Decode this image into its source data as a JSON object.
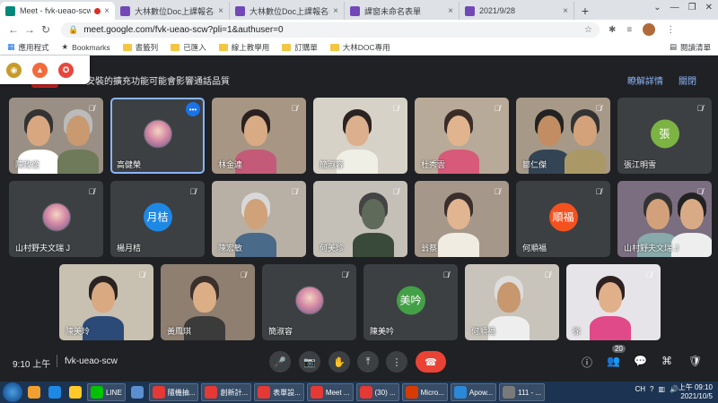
{
  "browser": {
    "tabs": [
      {
        "title": "Meet - fvk-ueao-scw",
        "fav_color": "#00897b",
        "active": true,
        "recording": true
      },
      {
        "title": "大林數位Doc上課報名表",
        "fav_color": "#7248b9",
        "active": false
      },
      {
        "title": "大林數位Doc上課報名表",
        "fav_color": "#7248b9",
        "active": false
      },
      {
        "title": "課窗未命名表單",
        "fav_color": "#7248b9",
        "active": false
      },
      {
        "title": "2021/9/28",
        "fav_color": "#7248b9",
        "active": false
      }
    ],
    "new_tab_label": "+",
    "close_glyph": "×",
    "url": "meet.google.com/fvk-ueao-scw?pli=1&authuser=0",
    "bookmarks": [
      {
        "label": "應用程式",
        "type": "apps"
      },
      {
        "label": "Bookmarks",
        "type": "star"
      },
      {
        "label": "書籤列",
        "type": "folder"
      },
      {
        "label": "已匯入",
        "type": "folder"
      },
      {
        "label": "線上教學用",
        "type": "folder"
      },
      {
        "label": "訂購單",
        "type": "folder"
      },
      {
        "label": "大林DOC專用",
        "type": "folder"
      }
    ],
    "reading_list_label": "閱讀清單"
  },
  "meet": {
    "banner_text": "安裝的擴充功能可能會影響通話品質",
    "banner_learn_more": "瞭解詳情",
    "banner_close": "關閉",
    "participants": [
      {
        "name": "陳政從",
        "kind": "video",
        "scene": "duo"
      },
      {
        "name": "高健榮",
        "kind": "photo_avatar",
        "speaking": true
      },
      {
        "name": "林金連",
        "kind": "video",
        "scene": "woman"
      },
      {
        "name": "簡淑容",
        "kind": "video",
        "scene": "woman2"
      },
      {
        "name": "杜秀雲",
        "kind": "video",
        "scene": "woman3"
      },
      {
        "name": "鄒仁傑",
        "kind": "video",
        "scene": "duo2"
      },
      {
        "name": "張江明雪",
        "kind": "letter_avatar",
        "initial": "張",
        "color": "#7cb342"
      },
      {
        "name": "山村野夫文瑞 J",
        "kind": "photo_avatar"
      },
      {
        "name": "楊月桔",
        "kind": "letter_avatar",
        "initial": "月桔",
        "color": "#1e88e5"
      },
      {
        "name": "陳宏敏",
        "kind": "video",
        "scene": "man"
      },
      {
        "name": "何美珍",
        "kind": "video",
        "scene": "room"
      },
      {
        "name": "翁蔡",
        "kind": "video",
        "scene": "woman4"
      },
      {
        "name": "何順福",
        "kind": "letter_avatar",
        "initial": "順福",
        "color": "#f4511e"
      },
      {
        "name": "山村野夫文瑞 J",
        "kind": "video",
        "scene": "duo3"
      },
      {
        "name": "陳美玲",
        "kind": "video",
        "scene": "woman5"
      },
      {
        "name": "黃鳳琪",
        "kind": "video",
        "scene": "woman6"
      },
      {
        "name": "簡淑容",
        "kind": "photo_avatar"
      },
      {
        "name": "陳美吟",
        "kind": "letter_avatar",
        "initial": "美吟",
        "color": "#43a047"
      },
      {
        "name": "何順福",
        "kind": "video",
        "scene": "man2"
      },
      {
        "name": "徐",
        "kind": "video",
        "scene": "woman7"
      }
    ],
    "time": "9:10 上午",
    "meeting_code": "fvk-ueao-scw",
    "participant_count": "20",
    "controls": {
      "mic": "🎤",
      "cam": "📷",
      "hand": "✋",
      "present": "⤒",
      "more": "⋮",
      "end": "☎"
    },
    "right_icons": {
      "info": "ⓘ",
      "people": "👥",
      "chat": "💬",
      "activities": "⌘",
      "host": "🛡"
    }
  },
  "taskbar": {
    "items": [
      {
        "label": "",
        "color": "#f0a030"
      },
      {
        "label": "",
        "color": "#1e88e5"
      },
      {
        "label": "",
        "color": "#ffca28"
      },
      {
        "label": "LINE",
        "color": "#00c300"
      },
      {
        "label": "",
        "color": "#5a8fd0"
      },
      {
        "label": "隨機抽...",
        "color": "#e53935"
      },
      {
        "label": "創新計...",
        "color": "#e53935"
      },
      {
        "label": "表單設...",
        "color": "#e53935"
      },
      {
        "label": "Meet ...",
        "color": "#e53935"
      },
      {
        "label": "(30) ...",
        "color": "#e53935"
      },
      {
        "label": "Micro...",
        "color": "#d83b01"
      },
      {
        "label": "Apow...",
        "color": "#2b88d8"
      },
      {
        "label": "111 - ...",
        "color": "#7a7a7a"
      }
    ],
    "lang": "CH",
    "clock_time": "上午 09:10",
    "clock_date": "2021/10/5"
  }
}
